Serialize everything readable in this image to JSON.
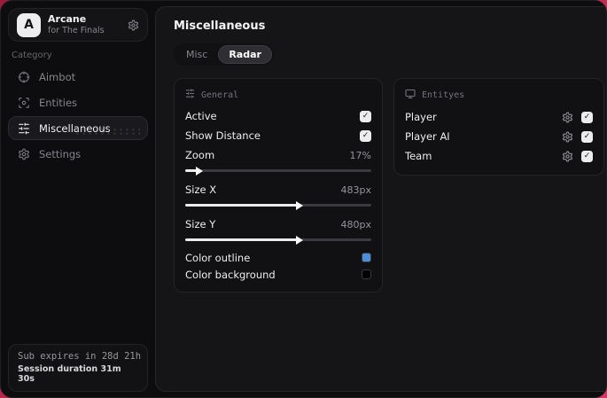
{
  "sidebar": {
    "brand": {
      "logo": "A",
      "title": "Arcane",
      "subtitle": "for The Finals"
    },
    "category_label": "Category",
    "items": [
      {
        "label": "Aimbot"
      },
      {
        "label": "Entities"
      },
      {
        "label": "Miscellaneous"
      },
      {
        "label": "Settings"
      }
    ],
    "footer": {
      "sub_expires": "Sub expires in 28d 21h",
      "session_duration": "Session duration 31m 30s"
    }
  },
  "main": {
    "title": "Miscellaneous",
    "tabs": [
      {
        "label": "Misc"
      },
      {
        "label": "Radar"
      }
    ],
    "general": {
      "title": "General",
      "active": {
        "label": "Active",
        "checked": true
      },
      "show_distance": {
        "label": "Show Distance",
        "checked": true
      },
      "zoom": {
        "label": "Zoom",
        "value": "17%",
        "fill": 6
      },
      "size_x": {
        "label": "Size X",
        "value": "483px",
        "fill": 60
      },
      "size_y": {
        "label": "Size Y",
        "value": "480px",
        "fill": 60
      },
      "color_outline": {
        "label": "Color outline",
        "color": "#4f8ed8"
      },
      "color_background": {
        "label": "Color background",
        "color": "#000000"
      }
    },
    "entities": {
      "title": "Entityes",
      "rows": [
        {
          "label": "Player",
          "checked": true
        },
        {
          "label": "Player AI",
          "checked": true
        },
        {
          "label": "Team",
          "checked": true
        }
      ]
    }
  },
  "glyphs": {
    "check": "✓"
  },
  "colors": {
    "accent_blue": "#4f8ed8",
    "swatch_black": "#000000",
    "backdrop_red": "#c22a52"
  }
}
